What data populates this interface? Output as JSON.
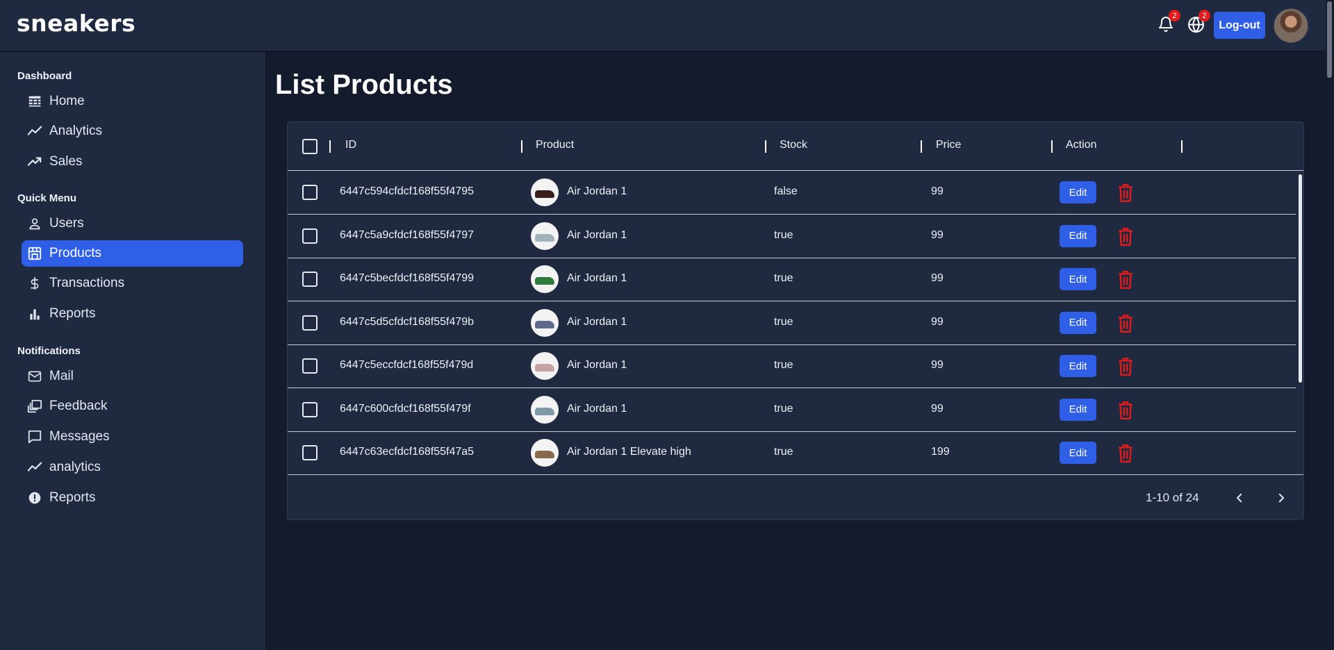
{
  "header": {
    "logo": "sneakers",
    "notifications_count": "2",
    "language_count": "2",
    "logout_label": "Log-out"
  },
  "sidebar": {
    "sections": [
      {
        "title": "Dashboard",
        "items": [
          {
            "label": "Home",
            "icon": "table-icon"
          },
          {
            "label": "Analytics",
            "icon": "line-chart-icon"
          },
          {
            "label": "Sales",
            "icon": "trending-up-icon"
          }
        ]
      },
      {
        "title": "Quick Menu",
        "items": [
          {
            "label": "Users",
            "icon": "user-icon"
          },
          {
            "label": "Products",
            "icon": "store-icon",
            "active": true
          },
          {
            "label": "Transactions",
            "icon": "dollar-icon"
          },
          {
            "label": "Reports",
            "icon": "bar-chart-icon"
          }
        ]
      },
      {
        "title": "Notifications",
        "items": [
          {
            "label": "Mail",
            "icon": "mail-icon"
          },
          {
            "label": "Feedback",
            "icon": "feedback-icon"
          },
          {
            "label": "Messages",
            "icon": "message-icon"
          },
          {
            "label": "analytics",
            "icon": "line-chart-icon"
          },
          {
            "label": "Reports",
            "icon": "report-icon"
          }
        ]
      }
    ]
  },
  "main": {
    "title": "List Products",
    "columns": [
      "ID",
      "Product",
      "Stock",
      "Price",
      "Action"
    ],
    "rows": [
      {
        "id": "6447c594cfdcf168f55f4795",
        "product": "Air Jordan 1",
        "stock": "false",
        "price": "99",
        "shoe_color": "#3a1f1f"
      },
      {
        "id": "6447c5a9cfdcf168f55f4797",
        "product": "Air Jordan 1",
        "stock": "true",
        "price": "99",
        "shoe_color": "#9fb3b8"
      },
      {
        "id": "6447c5becfdcf168f55f4799",
        "product": "Air Jordan 1",
        "stock": "true",
        "price": "99",
        "shoe_color": "#2e7a3c"
      },
      {
        "id": "6447c5d5cfdcf168f55f479b",
        "product": "Air Jordan 1",
        "stock": "true",
        "price": "99",
        "shoe_color": "#5d6a8c"
      },
      {
        "id": "6447c5eccfdcf168f55f479d",
        "product": "Air Jordan 1",
        "stock": "true",
        "price": "99",
        "shoe_color": "#c7a2a2"
      },
      {
        "id": "6447c600cfdcf168f55f479f",
        "product": "Air Jordan 1",
        "stock": "true",
        "price": "99",
        "shoe_color": "#7f9aa6"
      },
      {
        "id": "6447c63ecfdcf168f55f47a5",
        "product": "Air Jordan 1 Elevate high",
        "stock": "true",
        "price": "199",
        "shoe_color": "#8a6a4c"
      }
    ],
    "edit_label": "Edit",
    "pagination": "1-10 of 24"
  },
  "colors": {
    "accent": "#2f5fe6",
    "danger": "#e31b1b",
    "background": "#141b2d",
    "panel": "#1f2a40"
  }
}
